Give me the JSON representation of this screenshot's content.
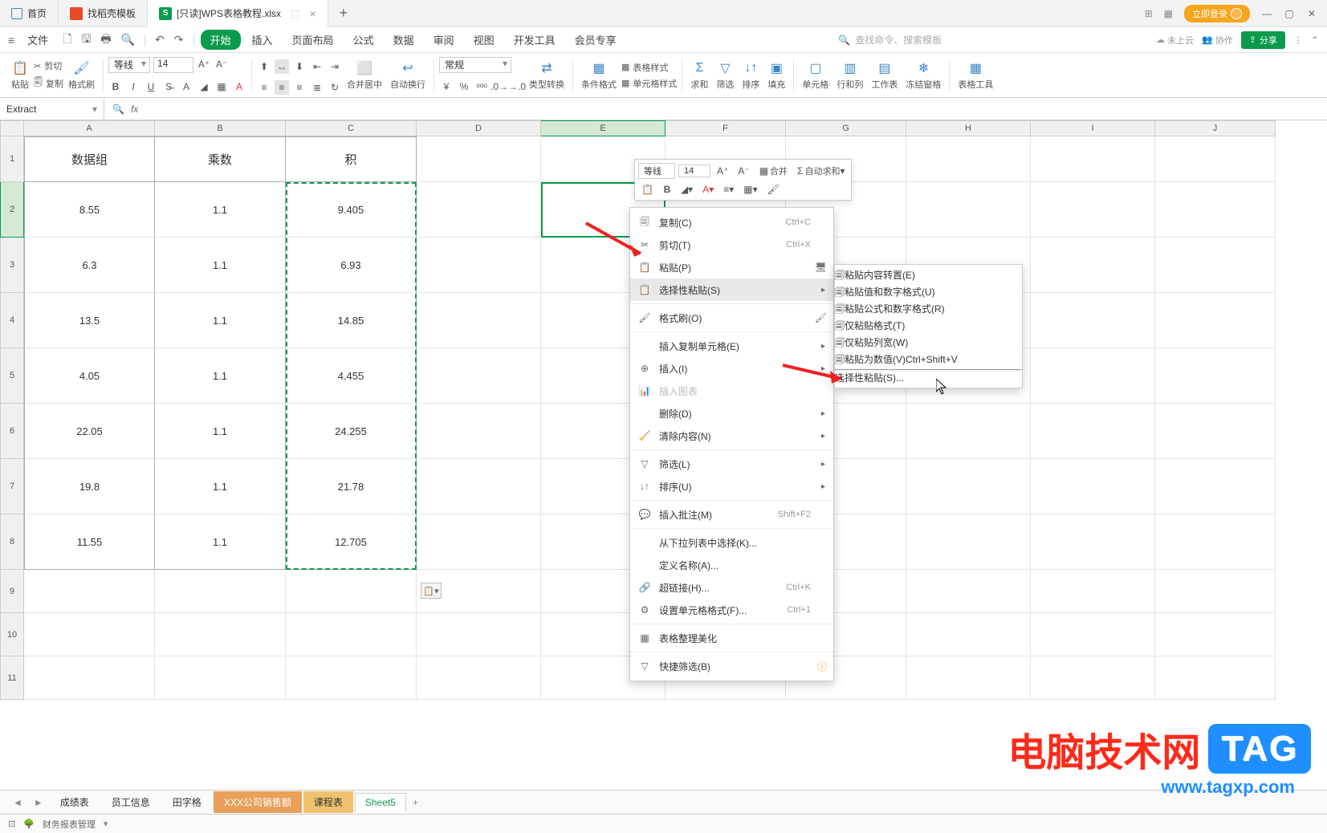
{
  "titlebar": {
    "tab_home": "首页",
    "tab_template": "找稻壳模板",
    "tab_file": "[只读]WPS表格教程.xlsx",
    "login_label": "立即登录"
  },
  "menubar": {
    "file": "文件",
    "items": [
      "开始",
      "插入",
      "页面布局",
      "公式",
      "数据",
      "审阅",
      "视图",
      "开发工具",
      "会员专享"
    ],
    "search_placeholder": "查找命令、搜索模板",
    "cloud_label": "未上云",
    "coop_label": "协作",
    "share_label": "分享"
  },
  "ribbon": {
    "paste_label": "粘贴",
    "cut_label": "剪切",
    "copy_label": "复制",
    "format_painter_label": "格式刷",
    "font_name": "等线",
    "font_size": "14",
    "merge_center": "合并居中",
    "auto_wrap": "自动换行",
    "number_format": "常规",
    "type_convert": "类型转换",
    "cond_format": "条件格式",
    "table_style": "表格样式",
    "cell_style": "单元格样式",
    "sum": "求和",
    "filter": "筛选",
    "sort": "排序",
    "fill": "填充",
    "cell": "单元格",
    "row_col": "行和列",
    "worksheet": "工作表",
    "freeze": "冻结窗格",
    "table_tools": "表格工具"
  },
  "formula_bar": {
    "name_box": "Extract"
  },
  "columns": [
    "A",
    "B",
    "C",
    "D",
    "E",
    "F",
    "G",
    "H",
    "I",
    "J"
  ],
  "rows": {
    "headers": [
      "1",
      "2",
      "3",
      "4",
      "5",
      "6",
      "7",
      "8",
      "9",
      "10",
      "11"
    ],
    "header_cells": {
      "A": "数据组",
      "B": "乘数",
      "C": "积"
    },
    "data": [
      {
        "A": "8.55",
        "B": "1.1",
        "C": "9.405"
      },
      {
        "A": "6.3",
        "B": "1.1",
        "C": "6.93"
      },
      {
        "A": "13.5",
        "B": "1.1",
        "C": "14.85"
      },
      {
        "A": "4.05",
        "B": "1.1",
        "C": "4.455"
      },
      {
        "A": "22.05",
        "B": "1.1",
        "C": "24.255"
      },
      {
        "A": "19.8",
        "B": "1.1",
        "C": "21.78"
      },
      {
        "A": "11.55",
        "B": "1.1",
        "C": "12.705"
      }
    ]
  },
  "mini_toolbar": {
    "font_name": "等线",
    "font_size": "14",
    "merge": "合并",
    "autosum": "自动求和"
  },
  "context_menu": {
    "copy": "复制(C)",
    "copy_sc": "Ctrl+C",
    "cut": "剪切(T)",
    "cut_sc": "Ctrl+X",
    "paste": "粘贴(P)",
    "paste_special": "选择性粘贴(S)",
    "format_painter": "格式刷(O)",
    "insert_copied": "插入复制单元格(E)",
    "insert": "插入(I)",
    "insert_chart": "插入图表",
    "delete": "删除(D)",
    "clear": "清除内容(N)",
    "filter": "筛选(L)",
    "sort": "排序(U)",
    "insert_comment": "插入批注(M)",
    "insert_comment_sc": "Shift+F2",
    "pick_list": "从下拉列表中选择(K)...",
    "define_name": "定义名称(A)...",
    "hyperlink": "超链接(H)...",
    "hyperlink_sc": "Ctrl+K",
    "format_cells": "设置单元格格式(F)...",
    "format_cells_sc": "Ctrl+1",
    "table_beautify": "表格整理美化",
    "quick_filter": "快捷筛选(B)"
  },
  "submenu": {
    "paste_content_transform": "粘贴内容转置(E)",
    "paste_value_numfmt": "粘贴值和数字格式(U)",
    "paste_formula_numfmt": "粘贴公式和数字格式(R)",
    "paste_format_only": "仅粘贴格式(T)",
    "paste_colwidth": "仅粘贴列宽(W)",
    "paste_as_value": "粘贴为数值(V)",
    "paste_as_value_sc": "Ctrl+Shift+V",
    "paste_special": "选择性粘贴(S)..."
  },
  "sheet_tabs": {
    "names": [
      "成绩表",
      "员工信息",
      "田字格",
      "XXX公司销售额",
      "课程表",
      "Sheet5"
    ]
  },
  "statusbar": {
    "label": "财务报表管理"
  },
  "watermark": {
    "text": "电脑技术网",
    "tag": "TAG",
    "url": "www.tagxp.com"
  }
}
